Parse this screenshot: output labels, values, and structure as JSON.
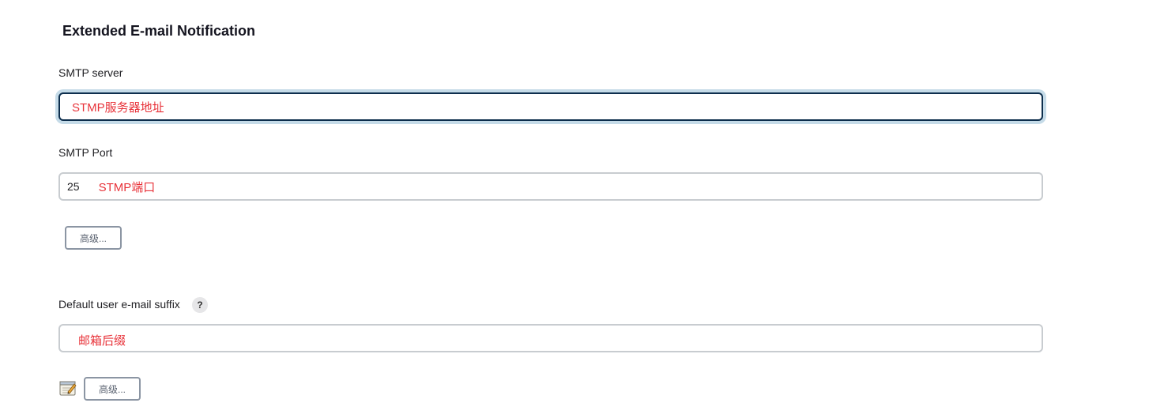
{
  "section": {
    "title": "Extended E-mail Notification"
  },
  "smtp_server": {
    "label": "SMTP server",
    "annotation": "STMP服务器地址"
  },
  "smtp_port": {
    "label": "SMTP Port",
    "value": "25",
    "annotation": "STMP端口"
  },
  "advanced_button_1": {
    "label": "高级..."
  },
  "default_suffix": {
    "label": "Default user e-mail suffix",
    "help": "?",
    "annotation": "邮箱后缀"
  },
  "advanced_button_2": {
    "label": "高级..."
  },
  "icons": {
    "help": "help-question-icon",
    "notepad": "notepad-edit-icon"
  },
  "colors": {
    "annotation": "#e8333a",
    "focus_border": "#0d2e4d",
    "focus_ring": "#c5dbe8",
    "input_border": "#c8ccd0",
    "button_border": "#8b95a3"
  }
}
